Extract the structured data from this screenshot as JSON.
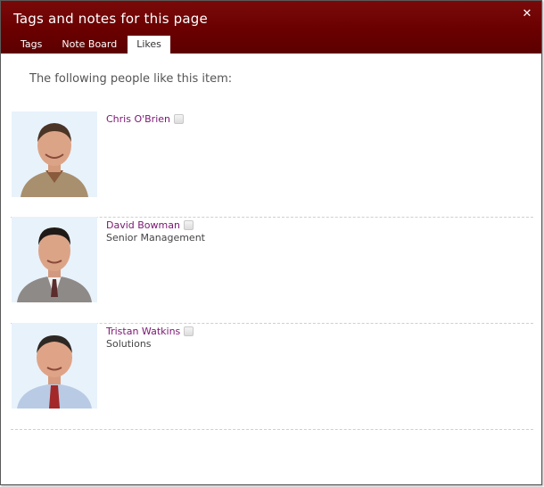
{
  "dialog": {
    "title": "Tags and notes for this page",
    "close_glyph": "✕",
    "accent_color": "#6a0000"
  },
  "tabs": [
    {
      "label": "Tags",
      "active": false
    },
    {
      "label": "Note Board",
      "active": false
    },
    {
      "label": "Likes",
      "active": true
    }
  ],
  "likes": {
    "intro": "The following people like this item:",
    "people": [
      {
        "name": "Chris O'Brien",
        "subtitle": "",
        "presence_icon": "presence-offline-icon"
      },
      {
        "name": "David Bowman",
        "subtitle": "Senior Management",
        "presence_icon": "presence-offline-icon"
      },
      {
        "name": "Tristan Watkins",
        "subtitle": "Solutions",
        "presence_icon": "presence-offline-icon"
      }
    ]
  }
}
